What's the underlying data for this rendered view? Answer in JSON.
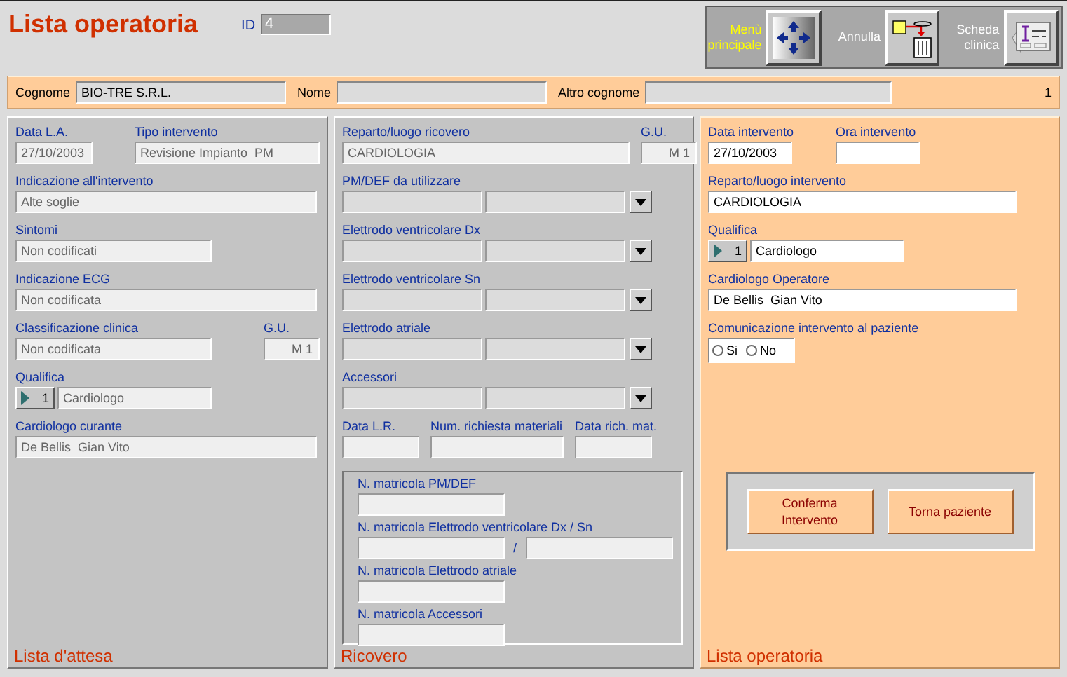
{
  "title": "Lista operatoria",
  "id": {
    "label": "ID",
    "value": "4"
  },
  "toolbar": [
    {
      "kind": "menu",
      "label": "Menù principale"
    },
    {
      "kind": "cancel",
      "label": "Annulla"
    },
    {
      "kind": "clinical",
      "label": "Scheda clinica"
    }
  ],
  "patient": {
    "fields": [
      {
        "label": "Cognome",
        "value": "BIO-TRE S.R.L."
      },
      {
        "label": "Nome"
      },
      {
        "label": "Altro cognome"
      }
    ],
    "count": "1"
  },
  "waiting_list": {
    "footer": "Lista d'attesa",
    "rows": [
      [
        {
          "kind": "text",
          "label": "Data L.A.",
          "value": "27/10/2003"
        },
        {
          "kind": "text",
          "label": "Tipo intervento",
          "value": "Revisione Impianto  PM"
        }
      ],
      [
        {
          "kind": "text",
          "label": "Indicazione all'intervento",
          "value": "Alte soglie"
        }
      ],
      [
        {
          "kind": "text",
          "label": "Sintomi",
          "value": "Non codificati"
        }
      ],
      [
        {
          "kind": "text",
          "label": "Indicazione ECG",
          "value": "Non codificata"
        }
      ],
      [
        {
          "kind": "text",
          "label": "Classificazione clinica",
          "value": "Non codificata"
        },
        {
          "kind": "text",
          "label": "G.U.",
          "value": "M 1"
        }
      ],
      [
        {
          "kind": "qualifica",
          "label": "Qualifica",
          "number": "1",
          "value": "Cardiologo"
        }
      ],
      [
        {
          "kind": "text",
          "label": "Cardiologo curante",
          "value": "De Bellis  Gian Vito"
        }
      ]
    ]
  },
  "admission": {
    "footer": "Ricovero",
    "rows": [
      [
        {
          "kind": "text",
          "label": "Reparto/luogo ricovero",
          "value": "CARDIOLOGIA"
        },
        {
          "kind": "text",
          "label": "G.U.",
          "value": "M 1"
        }
      ],
      [
        {
          "kind": "combo",
          "label": "PM/DEF da utilizzare"
        }
      ],
      [
        {
          "kind": "combo",
          "label": "Elettrodo ventricolare Dx"
        }
      ],
      [
        {
          "kind": "combo",
          "label": "Elettrodo ventricolare Sn"
        }
      ],
      [
        {
          "kind": "combo",
          "label": "Elettrodo atriale"
        }
      ],
      [
        {
          "kind": "combo",
          "label": "Accessori"
        }
      ],
      [
        {
          "kind": "text",
          "label": "Data L.R."
        },
        {
          "kind": "text",
          "label": "Num. richiesta materiali"
        },
        {
          "kind": "text",
          "label": "Data rich. mat."
        }
      ]
    ],
    "matricola": [
      {
        "kind": "text",
        "label": "N. matricola PM/DEF"
      },
      {
        "kind": "pair",
        "label": "N. matricola Elettrodo ventricolare Dx / Sn",
        "separator": "/"
      },
      {
        "kind": "text",
        "label": "N. matricola Elettrodo atriale"
      },
      {
        "kind": "text",
        "label": "N. matricola Accessori"
      }
    ]
  },
  "operation": {
    "footer": "Lista operatoria",
    "rows": [
      [
        {
          "kind": "text",
          "label": "Data intervento",
          "value": "27/10/2003"
        },
        {
          "kind": "text",
          "label": "Ora intervento"
        }
      ],
      [
        {
          "kind": "text",
          "label": "Reparto/luogo intervento",
          "value": "CARDIOLOGIA"
        }
      ],
      [
        {
          "kind": "qualifica",
          "label": "Qualifica",
          "number": "1",
          "value": "Cardiologo"
        }
      ],
      [
        {
          "kind": "text",
          "label": "Cardiologo Operatore",
          "value": "De Bellis  Gian Vito"
        }
      ],
      [
        {
          "kind": "radio",
          "label": "Comunicazione intervento al paziente",
          "options": [
            {
              "label": "Si",
              "selected": false
            },
            {
              "label": "No",
              "selected": false
            }
          ]
        }
      ]
    ],
    "buttons": [
      "Conferma Intervento",
      "Torna paziente"
    ]
  }
}
